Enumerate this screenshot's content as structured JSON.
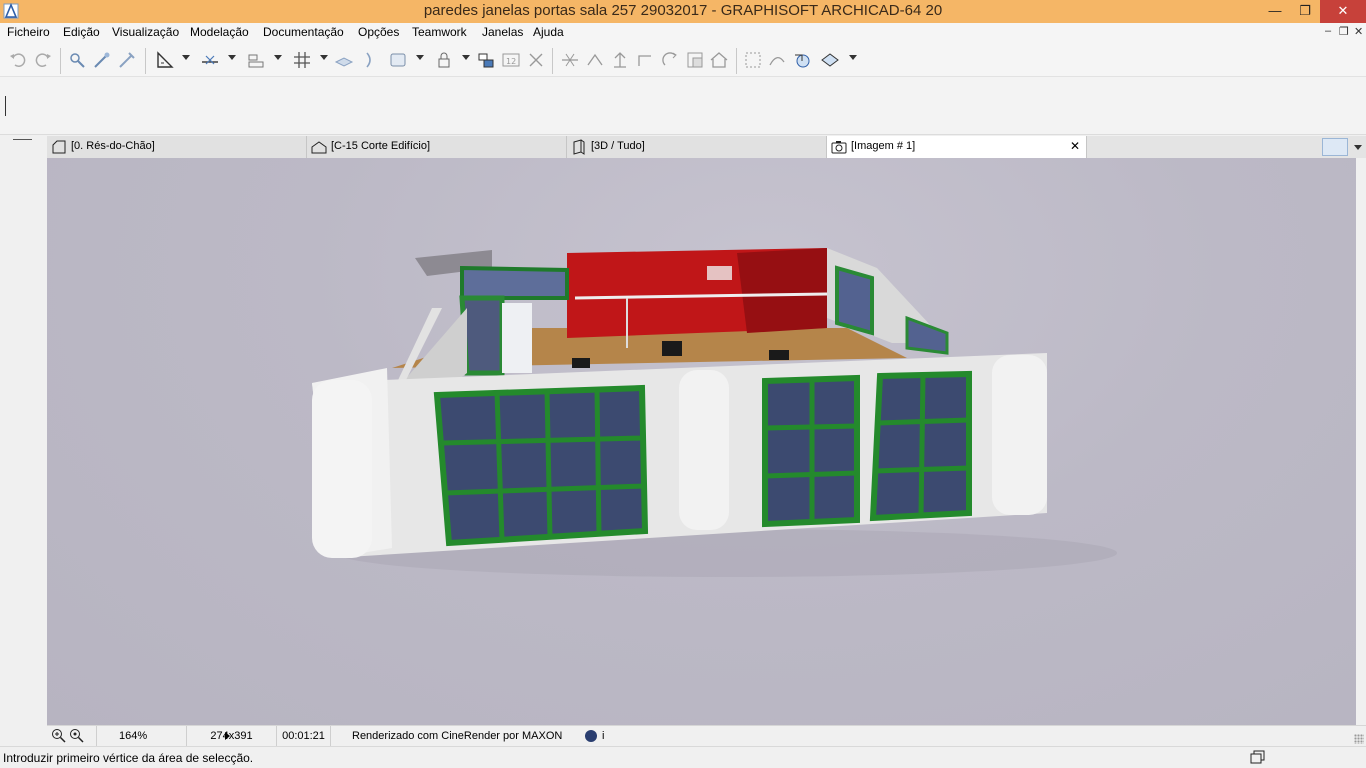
{
  "window": {
    "title": "paredes janelas portas sala 257 29032017 - GRAPHISOFT ARCHICAD-64 20",
    "controls": [
      "minimize",
      "restore",
      "close"
    ]
  },
  "menu": {
    "items": [
      "Ficheiro",
      "Edição",
      "Visualização",
      "Modelação",
      "Documentação",
      "Opções",
      "Teamwork",
      "Janelas",
      "Ajuda"
    ]
  },
  "toolbar": {
    "icons": [
      "undo-icon",
      "redo-icon",
      "select-icon",
      "pick-icon",
      "inject-icon",
      "measure-icon",
      "guide-icon",
      "snap-icon",
      "grid-icon",
      "layer-icon",
      "trace-icon",
      "view-icon",
      "lock-icon",
      "group-icon",
      "suspend-icon",
      "unlock-icon",
      "split-icon",
      "adjust-icon",
      "elevate-icon",
      "offset-icon",
      "rotate-icon",
      "drag-icon",
      "roof-icon",
      "render-icon",
      "sun-icon",
      "model-view-icon",
      "3d-window-icon"
    ]
  },
  "tabs": [
    {
      "label": "[0. Rés-do-Chão]",
      "icon": "floor-plan-icon",
      "active": false
    },
    {
      "label": "[C-15 Corte Edifício]",
      "icon": "section-icon",
      "active": false
    },
    {
      "label": "[3D / Tudo]",
      "icon": "3d-view-icon",
      "active": false
    },
    {
      "label": "[Imagem # 1]",
      "icon": "camera-icon",
      "active": true
    }
  ],
  "status": {
    "zoom": "164%",
    "size": "274x391",
    "time": "00:01:21",
    "render_info": "Renderizado com CineRender por MAXON",
    "info_label": "i"
  },
  "prompt": "Introduzir primeiro vértice da área de selecção."
}
